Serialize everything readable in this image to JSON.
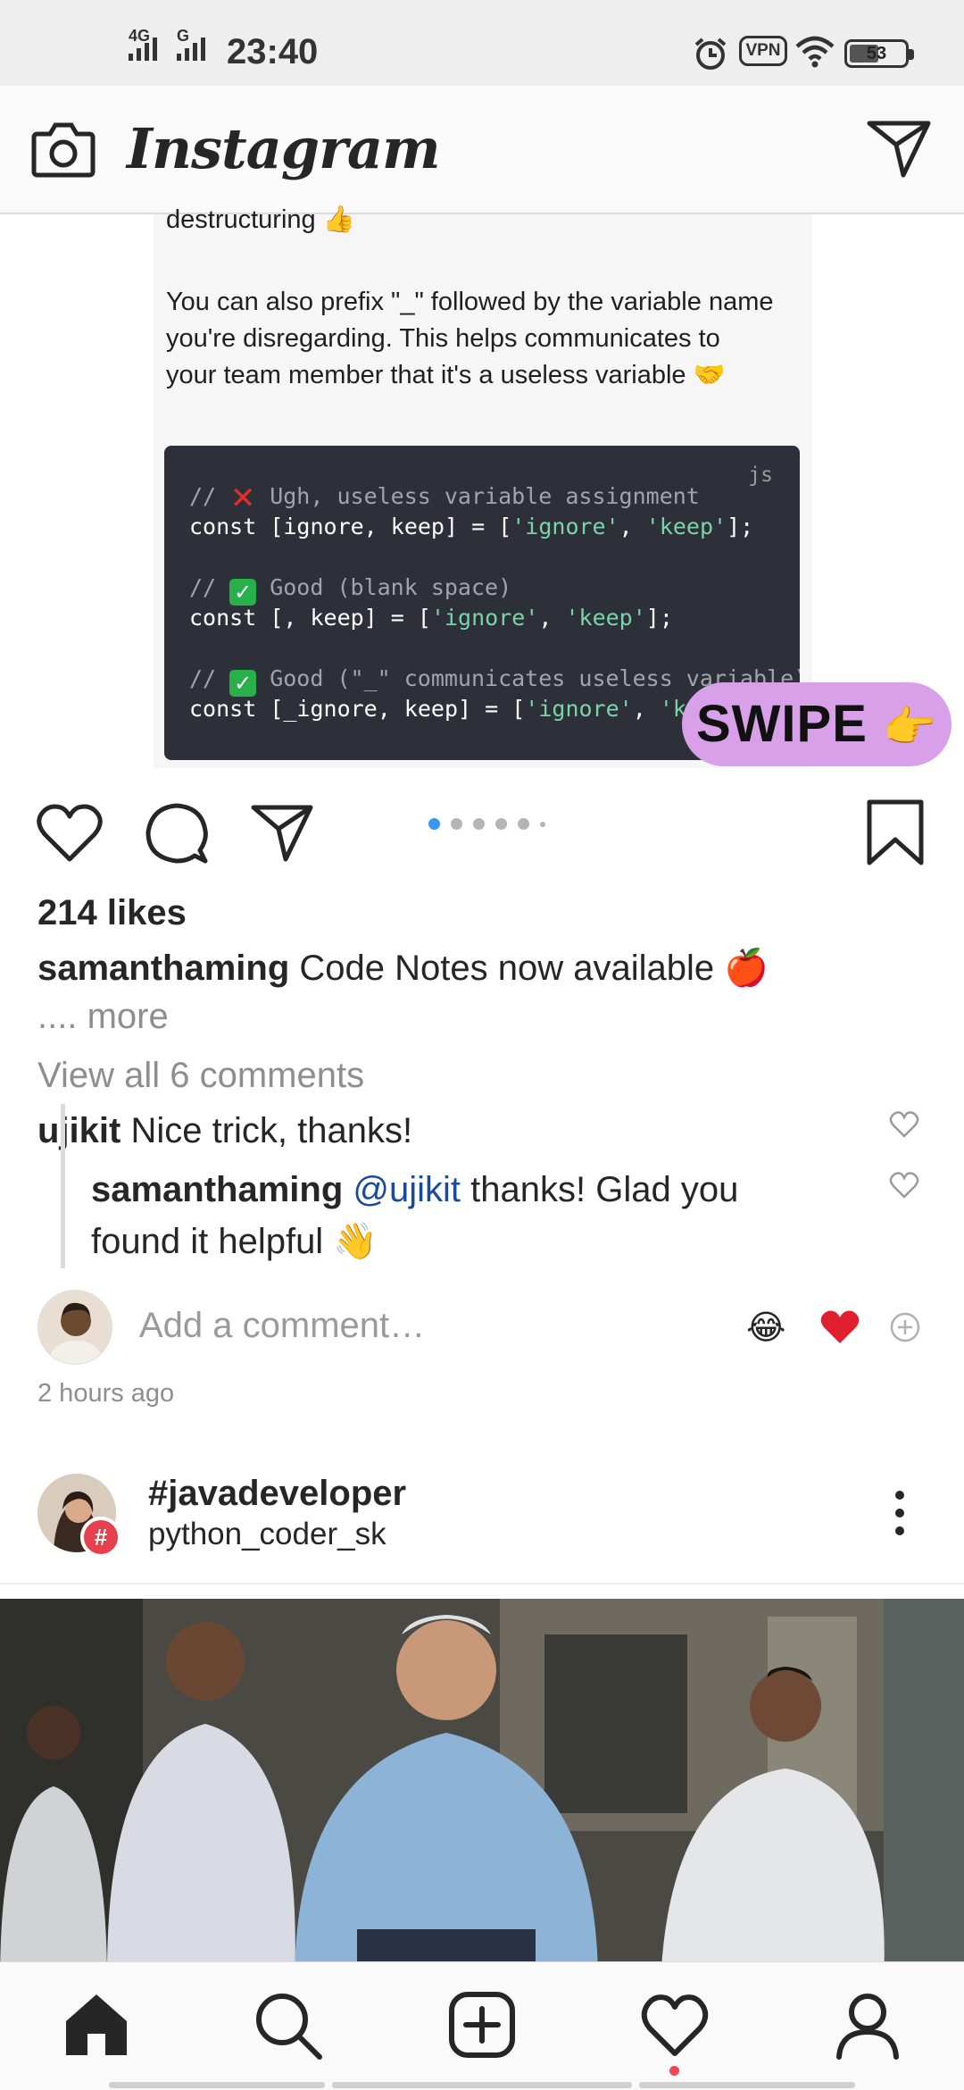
{
  "status_bar": {
    "network_1": "4G",
    "network_2": "G",
    "time": "23:40",
    "vpn": "VPN",
    "battery": "53",
    "icons": [
      "alarm-icon",
      "wifi-icon",
      "battery-icon"
    ]
  },
  "header": {
    "app_name": "Instagram",
    "icons": [
      "camera-icon",
      "direct-message-icon"
    ]
  },
  "post": {
    "slide_text": {
      "line_top": "destructuring 👍",
      "para_1": "You can also prefix \"_\" followed by the variable name",
      "para_2": "you're disregarding. This helps communicates to",
      "para_3": "your team member that it's a useless variable 🤝"
    },
    "code": {
      "lang": "js",
      "c1_pre": "// ",
      "c1_text": " Ugh, useless variable assignment",
      "k1": "const",
      "b1": " [ignore, keep] = [",
      "s1a": "'ignore'",
      "sep1": ", ",
      "s1b": "'keep'",
      "e1": "];",
      "c2_pre": "// ",
      "c2_text": " Good (blank space)",
      "k2": "const",
      "b2": " [, keep] = [",
      "s2a": "'ignore'",
      "sep2": ", ",
      "s2b": "'keep'",
      "e2": "];",
      "c3_pre": "// ",
      "c3_text": " Good (\"_\" communicates useless variable)",
      "k3": "const",
      "b3": " [_ignore, keep] = [",
      "s3a": "'ignore'",
      "sep3": ", ",
      "s3b": "'keep'",
      "e3": "];"
    },
    "swipe_label": "SWIPE",
    "swipe_emoji": "👉",
    "carousel": {
      "count": 6,
      "active_index": 0
    },
    "likes": "214 likes",
    "caption_user": "samanthaming",
    "caption_text": " Code Notes now available 🍎",
    "more": ".... more",
    "view_all_comments": "View all 6 comments",
    "comments": [
      {
        "user": "ujikit",
        "text": " Nice trick, thanks!"
      },
      {
        "user": "samanthaming",
        "mention": "@ujikit",
        "text_1": " thanks! Glad you",
        "text_2": "found it helpful 👋"
      }
    ],
    "add_comment_placeholder": "Add a comment…",
    "quick_reactions": [
      "😂",
      "❤️"
    ],
    "time_ago": "2 hours ago"
  },
  "post2": {
    "title": "#javadeveloper",
    "username": "python_coder_sk",
    "badge": "#"
  },
  "bottom_nav": [
    "home-icon",
    "search-icon",
    "new-post-icon",
    "activity-icon",
    "profile-icon"
  ],
  "colors": {
    "accent_blue": "#3897f0",
    "like_red": "#ed4956",
    "swipe_bg": "#d8a0e8",
    "code_bg": "#2d3039"
  }
}
